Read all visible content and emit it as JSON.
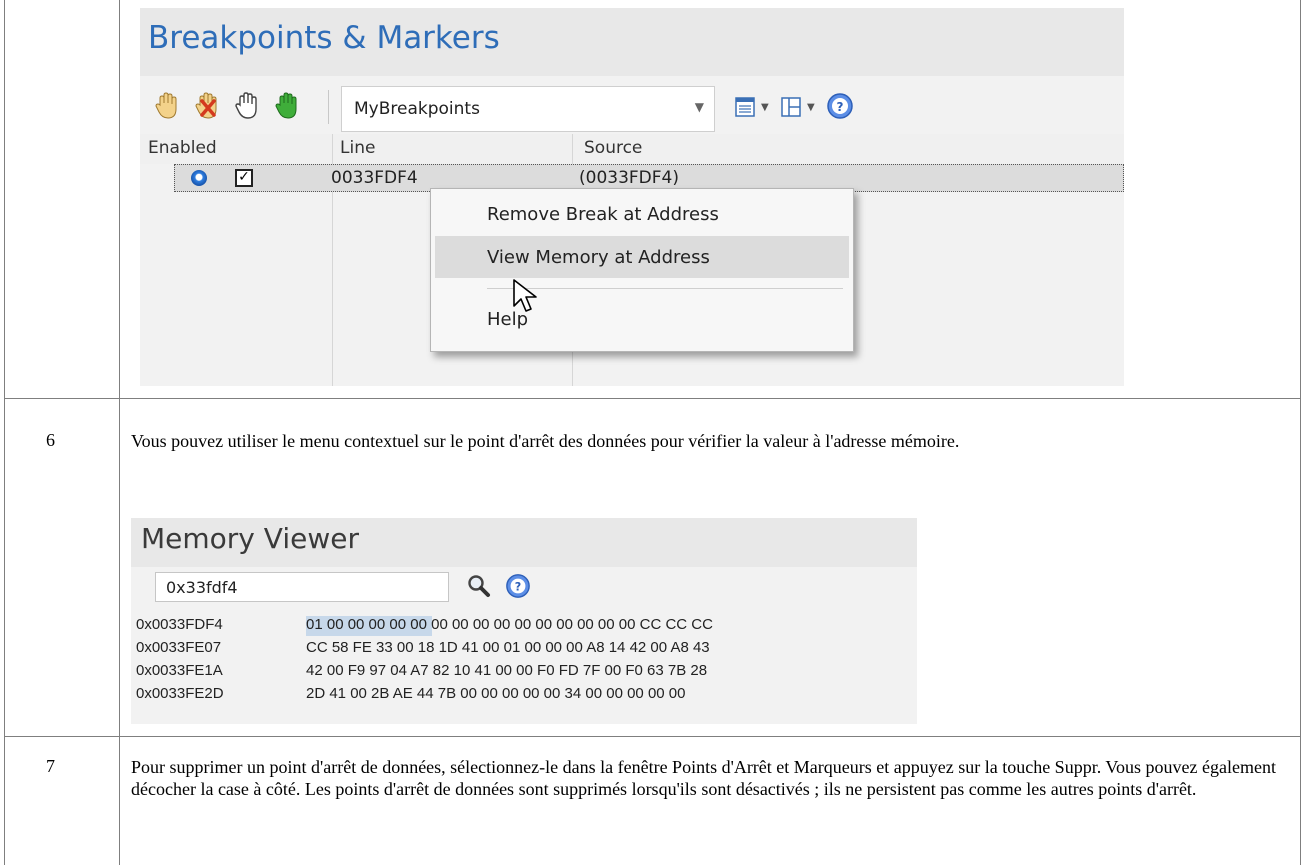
{
  "breakpoints_panel": {
    "title": "Breakpoints & Markers",
    "toolbar": {
      "icons": [
        "hand-enable-icon",
        "hand-delete-icon",
        "hand-outline-icon",
        "hand-green-icon"
      ],
      "set_selector_value": "MyBreakpoints",
      "list_icon": "list-view-icon",
      "layout_icon": "layout-grid-icon",
      "help_icon": "help-icon"
    },
    "columns": [
      "Enabled",
      "Line",
      "Source"
    ],
    "rows": [
      {
        "enabled": true,
        "line": "0033FDF4",
        "source": "(0033FDF4)"
      }
    ],
    "context_menu": {
      "items": [
        "Remove Break at Address",
        "View Memory at Address",
        "Help"
      ],
      "highlighted": "View Memory at Address"
    }
  },
  "steps": [
    {
      "number": "6",
      "text": "Vous pouvez utiliser le menu contextuel sur le point d'arrêt des données pour vérifier la valeur à l'adresse mémoire."
    },
    {
      "number": "7",
      "text": "Pour supprimer un point d'arrêt de données, sélectionnez-le dans la fenêtre Points d'Arrêt et Marqueurs et appuyez sur la touche Suppr. Vous pouvez également décocher la case à côté. Les points d'arrêt de données sont supprimés lorsqu'ils sont désactivés ; ils ne persistent pas comme les autres points d'arrêt."
    }
  ],
  "memory_viewer": {
    "title": "Memory Viewer",
    "address_input": "0x33fdf4",
    "rows": [
      {
        "address": "0x0033FDF4",
        "bytes": "01 00 00 00 00 00 00 00 00 00 00 00 00 00 00 00 CC CC CC"
      },
      {
        "address": "0x0033FE07",
        "bytes": "CC 58 FE 33 00 18 1D 41 00 01 00 00 00 A8 14 42 00 A8 43"
      },
      {
        "address": "0x0033FE1A",
        "bytes": "42 00 F9 97 04 A7 82 10 41 00 00 F0 FD 7F 00 F0 63 7B 28"
      },
      {
        "address": "0x0033FE2D",
        "bytes": "2D 41 00 2B AE 44 7B 00 00 00 00 00 34 00 00 00 00 00"
      }
    ]
  },
  "colors": {
    "title_blue": "#2e6db8",
    "selection_blue": "#c7d8ea",
    "panel_gray": "#f2f2f2"
  }
}
